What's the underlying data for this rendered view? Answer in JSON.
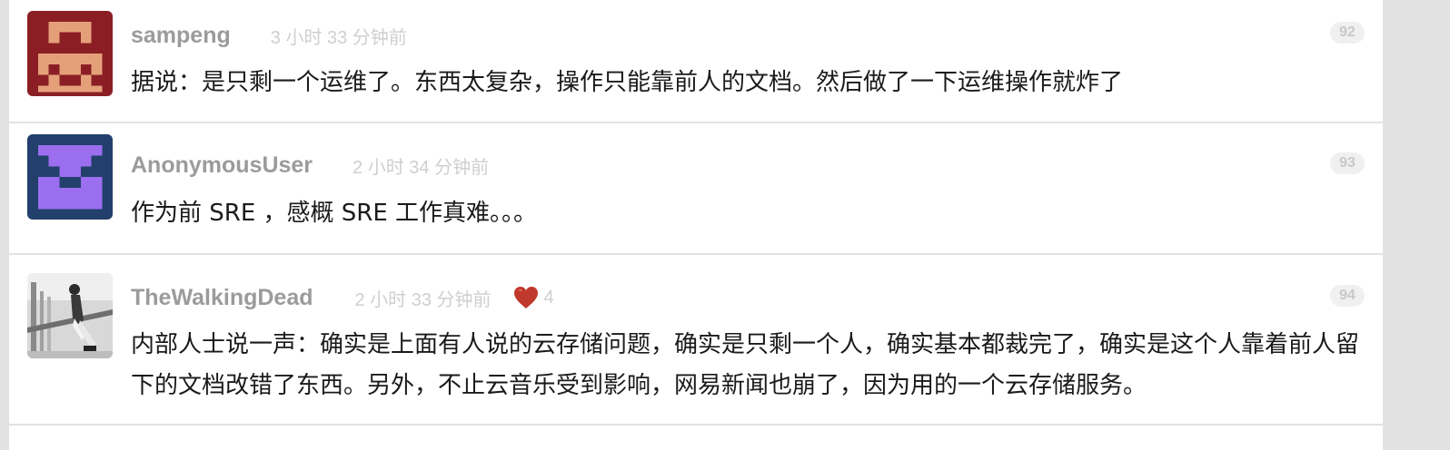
{
  "replies": [
    {
      "username": "sampeng",
      "time": "3 小时 33 分钟前",
      "floor": "92",
      "content": "据说：是只剩一个运维了。东西太复杂，操作只能靠前人的文档。然后做了一下运维操作就炸了",
      "avatar": "pixel-avatar-red"
    },
    {
      "username": "AnonymousUser",
      "time": "2 小时 34 分钟前",
      "floor": "93",
      "content": "作为前 SRE ，感概 SRE 工作真难。。。",
      "avatar": "pixel-avatar-purple"
    },
    {
      "username": "TheWalkingDead",
      "time": "2 小时 33 分钟前",
      "thanks": "4",
      "floor": "94",
      "content": "内部人士说一声：确实是上面有人说的云存储问题，确实是只剩一个人，确实基本都裁完了，确实是这个人靠着前人留下的文档改错了东西。另外，不止云音乐受到影响，网易新闻也崩了，因为用的一个云存储服务。",
      "avatar": "photo-avatar-grayscale"
    }
  ],
  "colors": {
    "background": "#e2e2e2",
    "username": "#9b9b9b",
    "meta": "#cfcfcf",
    "heart": "#c0392b"
  },
  "icons": {
    "thanks": "heart-icon"
  }
}
